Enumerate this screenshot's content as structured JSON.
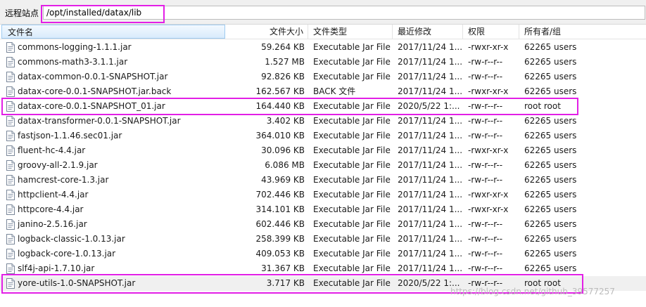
{
  "path_bar": {
    "label": "远程站点",
    "path": "/opt/installed/datax/lib"
  },
  "columns": {
    "name": "文件名",
    "size": "文件大小",
    "type": "文件类型",
    "modified": "最近修改",
    "permissions": "权限",
    "owner": "所有者/组"
  },
  "files": [
    {
      "name": "commons-logging-1.1.1.jar",
      "size": "59.264 KB",
      "type": "Executable Jar File",
      "modified": "2017/11/24 1...",
      "permissions": "-rwxr-xr-x",
      "owner": "62265 users"
    },
    {
      "name": "commons-math3-3.1.1.jar",
      "size": "1.527 MB",
      "type": "Executable Jar File",
      "modified": "2017/11/24 1...",
      "permissions": "-rw-r--r--",
      "owner": "62265 users"
    },
    {
      "name": "datax-common-0.0.1-SNAPSHOT.jar",
      "size": "92.826 KB",
      "type": "Executable Jar File",
      "modified": "2017/11/24 1...",
      "permissions": "-rw-r--r--",
      "owner": "62265 users"
    },
    {
      "name": "datax-core-0.0.1-SNAPSHOT.jar.back",
      "size": "162.567 KB",
      "type": "BACK 文件",
      "modified": "2017/11/24 1...",
      "permissions": "-rwxr-xr-x",
      "owner": "62265 users"
    },
    {
      "name": "datax-core-0.0.1-SNAPSHOT_01.jar",
      "size": "164.440 KB",
      "type": "Executable Jar File",
      "modified": "2020/5/22 1:...",
      "permissions": "-rw-r--r--",
      "owner": "root root"
    },
    {
      "name": "datax-transformer-0.0.1-SNAPSHOT.jar",
      "size": "3.402 KB",
      "type": "Executable Jar File",
      "modified": "2017/11/24 1...",
      "permissions": "-rw-r--r--",
      "owner": "62265 users"
    },
    {
      "name": "fastjson-1.1.46.sec01.jar",
      "size": "364.010 KB",
      "type": "Executable Jar File",
      "modified": "2017/11/24 1...",
      "permissions": "-rw-r--r--",
      "owner": "62265 users"
    },
    {
      "name": "fluent-hc-4.4.jar",
      "size": "30.096 KB",
      "type": "Executable Jar File",
      "modified": "2017/11/24 1...",
      "permissions": "-rwxr-xr-x",
      "owner": "62265 users"
    },
    {
      "name": "groovy-all-2.1.9.jar",
      "size": "6.086 MB",
      "type": "Executable Jar File",
      "modified": "2017/11/24 1...",
      "permissions": "-rw-r--r--",
      "owner": "62265 users"
    },
    {
      "name": "hamcrest-core-1.3.jar",
      "size": "43.969 KB",
      "type": "Executable Jar File",
      "modified": "2017/11/24 1...",
      "permissions": "-rw-r--r--",
      "owner": "62265 users"
    },
    {
      "name": "httpclient-4.4.jar",
      "size": "702.446 KB",
      "type": "Executable Jar File",
      "modified": "2017/11/24 1...",
      "permissions": "-rwxr-xr-x",
      "owner": "62265 users"
    },
    {
      "name": "httpcore-4.4.jar",
      "size": "314.101 KB",
      "type": "Executable Jar File",
      "modified": "2017/11/24 1...",
      "permissions": "-rwxr-xr-x",
      "owner": "62265 users"
    },
    {
      "name": "janino-2.5.16.jar",
      "size": "602.446 KB",
      "type": "Executable Jar File",
      "modified": "2017/11/24 1...",
      "permissions": "-rw-r--r--",
      "owner": "62265 users"
    },
    {
      "name": "logback-classic-1.0.13.jar",
      "size": "258.399 KB",
      "type": "Executable Jar File",
      "modified": "2017/11/24 1...",
      "permissions": "-rw-r--r--",
      "owner": "62265 users"
    },
    {
      "name": "logback-core-1.0.13.jar",
      "size": "409.053 KB",
      "type": "Executable Jar File",
      "modified": "2017/11/24 1...",
      "permissions": "-rw-r--r--",
      "owner": "62265 users"
    },
    {
      "name": "slf4j-api-1.7.10.jar",
      "size": "31.367 KB",
      "type": "Executable Jar File",
      "modified": "2017/11/24 1...",
      "permissions": "-rw-r--r--",
      "owner": "62265 users"
    },
    {
      "name": "yore-utils-1.0-SNAPSHOT.jar",
      "size": "3.717 KB",
      "type": "Executable Jar File",
      "modified": "2020/5/22 1:...",
      "permissions": "-rw-r--r--",
      "owner": "root root"
    }
  ],
  "selected_index": 16,
  "highlight_color": "#e21fe6",
  "watermark": "https://blog.csdn.net/github_39577257"
}
